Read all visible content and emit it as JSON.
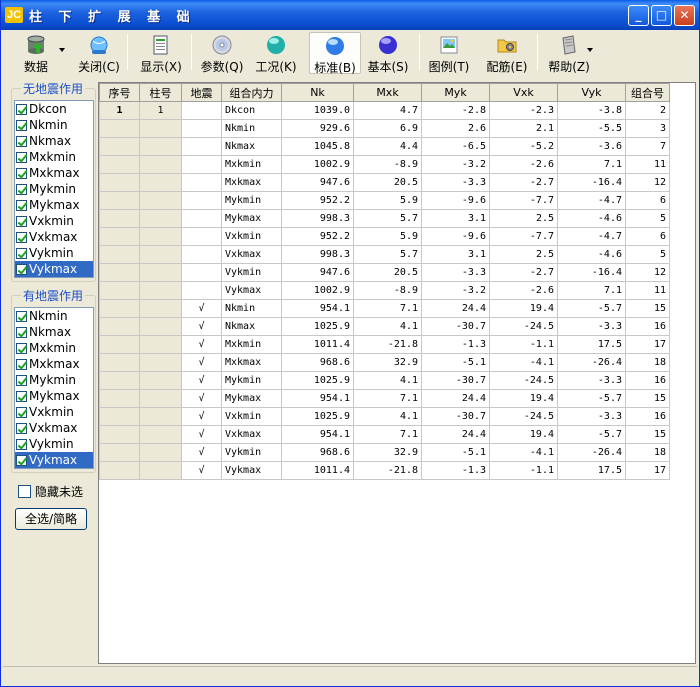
{
  "window": {
    "app_icon": "JC",
    "title": "柱 下 扩 展 基 础"
  },
  "titlebar_buttons": {
    "minimize": "_",
    "maximize": "□",
    "close": "✕"
  },
  "toolbar": [
    {
      "label": "数据",
      "icon": "database-icon",
      "dropdown": true
    },
    {
      "label": "关闭(C)",
      "icon": "close-globe-icon"
    },
    {
      "label": "显示(X)",
      "icon": "document-icon"
    },
    {
      "label": "参数(Q)",
      "icon": "cd-icon"
    },
    {
      "label": "工况(K)",
      "icon": "teal-sphere-icon"
    },
    {
      "label": "标准(B)",
      "icon": "blue-sphere-icon",
      "active": true
    },
    {
      "label": "基本(S)",
      "icon": "purple-sphere-icon"
    },
    {
      "label": "图例(T)",
      "icon": "image-icon"
    },
    {
      "label": "配筋(E)",
      "icon": "folder-gear-icon"
    },
    {
      "label": "帮助(Z)",
      "icon": "help-icon",
      "dropdown": true
    }
  ],
  "no_quake": {
    "title": "无地震作用",
    "items": [
      "Dkcon",
      "Nkmin",
      "Nkmax",
      "Mxkmin",
      "Mxkmax",
      "Mykmin",
      "Mykmax",
      "Vxkmin",
      "Vxkmax",
      "Vykmin",
      "Vykmax"
    ],
    "selected": 10
  },
  "with_quake": {
    "title": "有地震作用",
    "items": [
      "Nkmin",
      "Nkmax",
      "Mxkmin",
      "Mxkmax",
      "Mykmin",
      "Mykmax",
      "Vxkmin",
      "Vxkmax",
      "Vykmin",
      "Vykmax"
    ],
    "selected": 9
  },
  "hide_unselected_label": "隐藏未选",
  "select_all_button": "全选/简略",
  "table": {
    "headers": [
      "序号",
      "柱号",
      "地震",
      "组合内力",
      "Nk",
      "Mxk",
      "Myk",
      "Vxk",
      "Vyk",
      "组合号"
    ],
    "rows": [
      [
        "1",
        "1",
        "",
        "Dkcon",
        "1039.0",
        "4.7",
        "-2.8",
        "-2.3",
        "-3.8",
        "2"
      ],
      [
        "",
        "",
        "",
        "Nkmin",
        "929.6",
        "6.9",
        "2.6",
        "2.1",
        "-5.5",
        "3"
      ],
      [
        "",
        "",
        "",
        "Nkmax",
        "1045.8",
        "4.4",
        "-6.5",
        "-5.2",
        "-3.6",
        "7"
      ],
      [
        "",
        "",
        "",
        "Mxkmin",
        "1002.9",
        "-8.9",
        "-3.2",
        "-2.6",
        "7.1",
        "11"
      ],
      [
        "",
        "",
        "",
        "Mxkmax",
        "947.6",
        "20.5",
        "-3.3",
        "-2.7",
        "-16.4",
        "12"
      ],
      [
        "",
        "",
        "",
        "Mykmin",
        "952.2",
        "5.9",
        "-9.6",
        "-7.7",
        "-4.7",
        "6"
      ],
      [
        "",
        "",
        "",
        "Mykmax",
        "998.3",
        "5.7",
        "3.1",
        "2.5",
        "-4.6",
        "5"
      ],
      [
        "",
        "",
        "",
        "Vxkmin",
        "952.2",
        "5.9",
        "-9.6",
        "-7.7",
        "-4.7",
        "6"
      ],
      [
        "",
        "",
        "",
        "Vxkmax",
        "998.3",
        "5.7",
        "3.1",
        "2.5",
        "-4.6",
        "5"
      ],
      [
        "",
        "",
        "",
        "Vykmin",
        "947.6",
        "20.5",
        "-3.3",
        "-2.7",
        "-16.4",
        "12"
      ],
      [
        "",
        "",
        "",
        "Vykmax",
        "1002.9",
        "-8.9",
        "-3.2",
        "-2.6",
        "7.1",
        "11"
      ],
      [
        "",
        "",
        "√",
        "Nkmin",
        "954.1",
        "7.1",
        "24.4",
        "19.4",
        "-5.7",
        "15"
      ],
      [
        "",
        "",
        "√",
        "Nkmax",
        "1025.9",
        "4.1",
        "-30.7",
        "-24.5",
        "-3.3",
        "16"
      ],
      [
        "",
        "",
        "√",
        "Mxkmin",
        "1011.4",
        "-21.8",
        "-1.3",
        "-1.1",
        "17.5",
        "17"
      ],
      [
        "",
        "",
        "√",
        "Mxkmax",
        "968.6",
        "32.9",
        "-5.1",
        "-4.1",
        "-26.4",
        "18"
      ],
      [
        "",
        "",
        "√",
        "Mykmin",
        "1025.9",
        "4.1",
        "-30.7",
        "-24.5",
        "-3.3",
        "16"
      ],
      [
        "",
        "",
        "√",
        "Mykmax",
        "954.1",
        "7.1",
        "24.4",
        "19.4",
        "-5.7",
        "15"
      ],
      [
        "",
        "",
        "√",
        "Vxkmin",
        "1025.9",
        "4.1",
        "-30.7",
        "-24.5",
        "-3.3",
        "16"
      ],
      [
        "",
        "",
        "√",
        "Vxkmax",
        "954.1",
        "7.1",
        "24.4",
        "19.4",
        "-5.7",
        "15"
      ],
      [
        "",
        "",
        "√",
        "Vykmin",
        "968.6",
        "32.9",
        "-5.1",
        "-4.1",
        "-26.4",
        "18"
      ],
      [
        "",
        "",
        "√",
        "Vykmax",
        "1011.4",
        "-21.8",
        "-1.3",
        "-1.1",
        "17.5",
        "17"
      ]
    ]
  }
}
